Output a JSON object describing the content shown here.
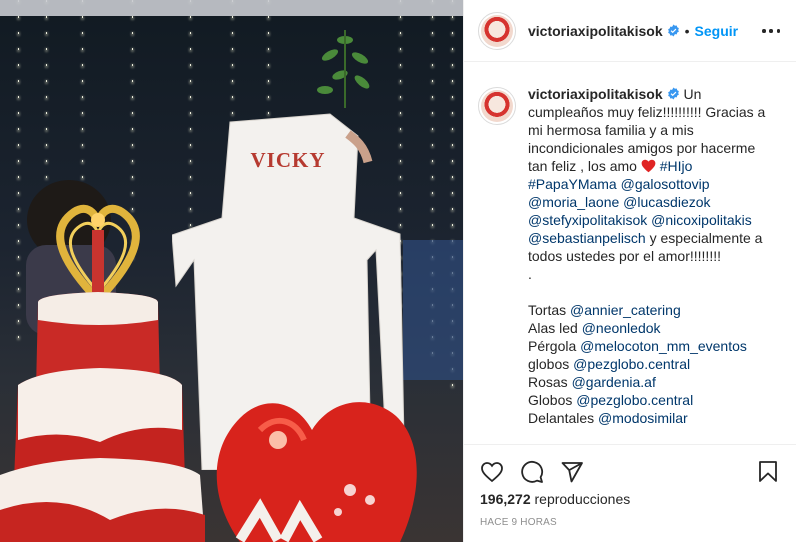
{
  "header": {
    "username": "victoriaxipolitakisok",
    "separator": "•",
    "follow_label": "Seguir"
  },
  "media": {
    "sign_text": "VICKY"
  },
  "caption": {
    "username": "victoriaxipolitakisok",
    "text_1": "Un cumpleaños muy feliz!!!!!!!!!! Gracias a mi hermosa familia y a mis incondicionales amigos por hacerme tan feliz , los amo",
    "hashtags": [
      "#HIjo",
      "#PapaYMama"
    ],
    "mentions_1": [
      "@galosottovip",
      "@moria_laone",
      "@lucasdiezok",
      "@stefyxipolitakisok",
      "@nicoxipolitakis",
      "@sebastianpelisch"
    ],
    "text_2": "y especialmente a todos ustedes por el amor!!!!!!!!",
    "dot": ".",
    "credits": [
      {
        "label": "Tortas",
        "handle": "@annier_catering"
      },
      {
        "label": "Alas led",
        "handle": "@neonledok"
      },
      {
        "label": "Pérgola",
        "handle": "@melocoton_mm_eventos"
      },
      {
        "label": "globos",
        "handle": "@pezglobo.central"
      },
      {
        "label": "Rosas",
        "handle": "@gardenia.af"
      },
      {
        "label": "Globos",
        "handle": "@pezglobo.central"
      },
      {
        "label": "Delantales",
        "handle": "@modosimilar"
      }
    ]
  },
  "stats": {
    "views_count": "196,272",
    "views_label": "reproducciones",
    "timestamp": "HACE 9 HORAS"
  },
  "icons": {
    "like": "heart-outline-icon",
    "comment": "comment-icon",
    "share": "paper-plane-icon",
    "save": "bookmark-icon",
    "more": "more-horizontal-icon",
    "verified": "verified-badge-icon"
  },
  "colors": {
    "link": "#00376b",
    "follow": "#0095f6",
    "verified": "#3897f0",
    "heart": "#ed4956",
    "muted": "#8e8e8e"
  }
}
